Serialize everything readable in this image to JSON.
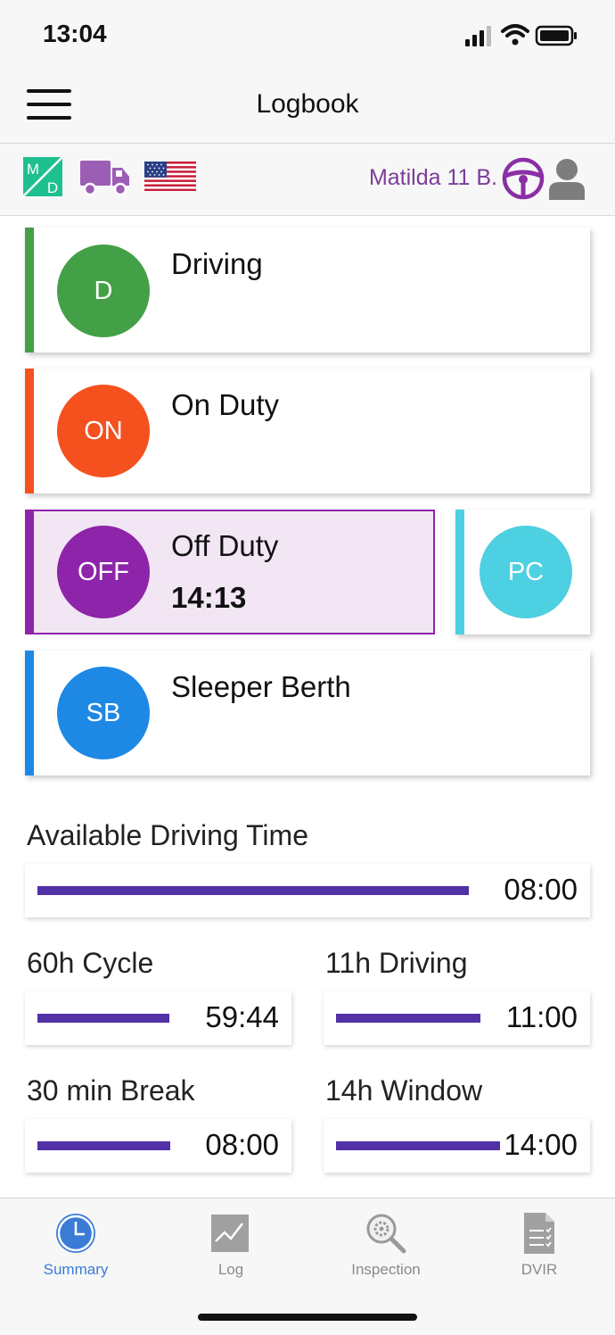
{
  "status_bar": {
    "time": "13:04"
  },
  "header": {
    "title": "Logbook"
  },
  "info_bar": {
    "logo_text": {
      "top": "M",
      "bottom": "D"
    },
    "driver_name": "Matilda 11 B.",
    "icons": [
      "md-logo",
      "truck-icon",
      "us-flag-icon",
      "steering-wheel-icon",
      "user-icon"
    ]
  },
  "duty_statuses": [
    {
      "code": "D",
      "label": "Driving",
      "color": "#43a047"
    },
    {
      "code": "ON",
      "label": "On Duty",
      "color": "#f4511e"
    },
    {
      "code": "OFF",
      "label": "Off Duty",
      "time": "14:13",
      "color": "#8e24aa",
      "selected": true
    },
    {
      "code": "PC",
      "label": "",
      "color": "#4dd0e1"
    },
    {
      "code": "SB",
      "label": "Sleeper Berth",
      "color": "#1e88e5"
    }
  ],
  "timers": {
    "available": {
      "label": "Available Driving Time",
      "value": "08:00",
      "progress": 1.0
    },
    "cycle": {
      "label": "60h Cycle",
      "value": "59:44",
      "progress": 1.0
    },
    "driving": {
      "label": "11h Driving",
      "value": "11:00",
      "progress": 1.0
    },
    "break": {
      "label": "30 min Break",
      "value": "08:00",
      "progress": 1.0
    },
    "window": {
      "label": "14h Window",
      "value": "14:00",
      "progress": 1.0
    }
  },
  "colors": {
    "accent": "#5230a6",
    "selected_bg": "#f2e6f5",
    "tab_active": "#3a7bd5"
  },
  "tabs": [
    {
      "label": "Summary",
      "icon": "clock-icon",
      "active": true
    },
    {
      "label": "Log",
      "icon": "chart-icon",
      "active": false
    },
    {
      "label": "Inspection",
      "icon": "inspection-icon",
      "active": false
    },
    {
      "label": "DVIR",
      "icon": "document-icon",
      "active": false
    }
  ]
}
